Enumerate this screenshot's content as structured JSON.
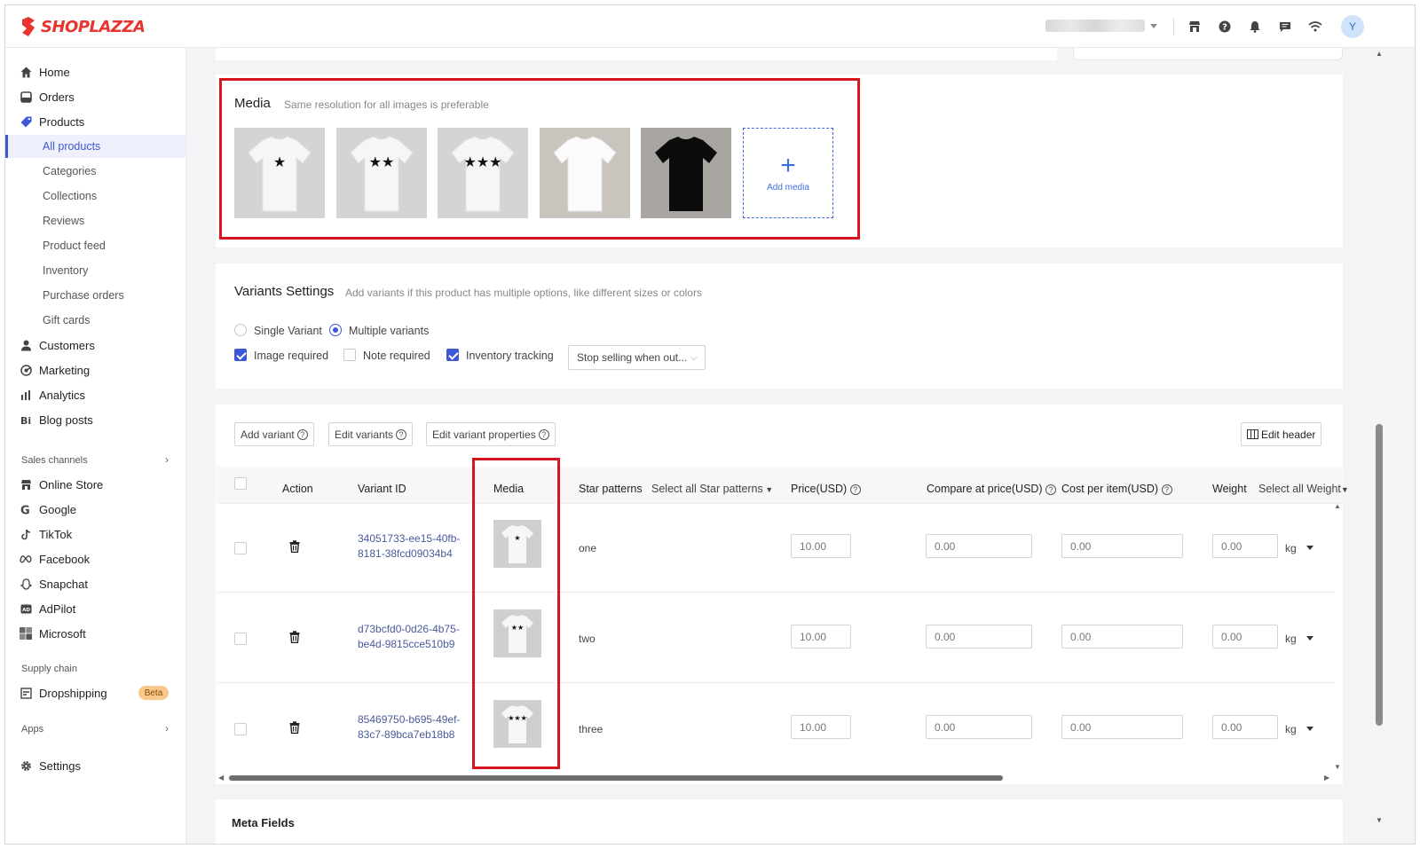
{
  "brand": {
    "name": "SHOPLAZZA",
    "color": "#e8352f"
  },
  "topbar": {
    "icons": [
      "store-icon",
      "help-icon",
      "bell-icon",
      "chat-icon",
      "wifi-icon"
    ],
    "avatar_initial": "Y"
  },
  "sidebar": {
    "items": [
      {
        "label": "Home",
        "icon": "home-icon"
      },
      {
        "label": "Orders",
        "icon": "orders-icon"
      },
      {
        "label": "Products",
        "icon": "tag-icon"
      },
      {
        "label": "Customers",
        "icon": "person-icon"
      },
      {
        "label": "Marketing",
        "icon": "marketing-icon"
      },
      {
        "label": "Analytics",
        "icon": "bar-chart-icon"
      },
      {
        "label": "Blog posts",
        "icon": "blog-icon"
      }
    ],
    "product_subitems": [
      "All products",
      "Categories",
      "Collections",
      "Reviews",
      "Product feed",
      "Inventory",
      "Purchase orders",
      "Gift cards"
    ],
    "sales_channels_label": "Sales channels",
    "channels": [
      {
        "label": "Online Store",
        "icon": "store-icon"
      },
      {
        "label": "Google",
        "icon": "google-icon"
      },
      {
        "label": "TikTok",
        "icon": "tiktok-icon"
      },
      {
        "label": "Facebook",
        "icon": "meta-icon"
      },
      {
        "label": "Snapchat",
        "icon": "snapchat-icon"
      },
      {
        "label": "AdPilot",
        "icon": "adpilot-icon"
      },
      {
        "label": "Microsoft",
        "icon": "microsoft-icon"
      }
    ],
    "supply_chain_label": "Supply chain",
    "dropshipping_label": "Dropshipping",
    "beta_label": "Beta",
    "apps_label": "Apps",
    "settings_label": "Settings"
  },
  "media": {
    "title": "Media",
    "subtitle": "Same resolution for all images is preferable",
    "images": [
      {
        "stars": "★",
        "shirt_color": "white"
      },
      {
        "stars": "★★",
        "shirt_color": "white"
      },
      {
        "stars": "★★★",
        "shirt_color": "white"
      },
      {
        "stars": "",
        "shirt_color": "white"
      },
      {
        "stars": "",
        "shirt_color": "black"
      }
    ],
    "add_label": "Add media"
  },
  "variants_settings": {
    "title": "Variants Settings",
    "subtitle": "Add variants if this product has multiple options, like different sizes or colors",
    "single_label": "Single Variant",
    "multiple_label": "Multiple variants",
    "selected": "Multiple variants",
    "image_required_label": "Image required",
    "image_required": true,
    "note_required_label": "Note required",
    "note_required": false,
    "inventory_tracking_label": "Inventory tracking",
    "inventory_tracking": true,
    "stop_selling_value": "Stop selling when out..."
  },
  "variants_table": {
    "toolbar": {
      "add_variant": "Add variant",
      "edit_variants": "Edit variants",
      "edit_properties": "Edit variant properties",
      "edit_header": "Edit header"
    },
    "headers": {
      "action": "Action",
      "variant_id": "Variant ID",
      "media": "Media",
      "star_patterns": "Star patterns",
      "star_select_all": "Select all Star patterns",
      "price": "Price(USD)",
      "compare": "Compare at price(USD)",
      "cost": "Cost per item(USD)",
      "weight": "Weight",
      "weight_select_all": "Select all Weight"
    },
    "rows": [
      {
        "id_line1": "34051733-ee15-40fb-",
        "id_line2": "8181-38fcd09034b4",
        "stars": "★",
        "pattern": "one",
        "price": "10.00",
        "compare": "0.00",
        "cost": "0.00",
        "weight": "0.00",
        "unit": "kg"
      },
      {
        "id_line1": "d73bcfd0-0d26-4b75-",
        "id_line2": "be4d-9815cce510b9",
        "stars": "★★",
        "pattern": "two",
        "price": "10.00",
        "compare": "0.00",
        "cost": "0.00",
        "weight": "0.00",
        "unit": "kg"
      },
      {
        "id_line1": "85469750-b695-49ef-",
        "id_line2": "83c7-89bca7eb18b8",
        "stars": "★★★",
        "pattern": "three",
        "price": "10.00",
        "compare": "0.00",
        "cost": "0.00",
        "weight": "0.00",
        "unit": "kg"
      }
    ]
  },
  "meta_fields": {
    "title": "Meta Fields"
  },
  "colors": {
    "accent": "#3d57d6",
    "highlight": "#d8141e"
  }
}
